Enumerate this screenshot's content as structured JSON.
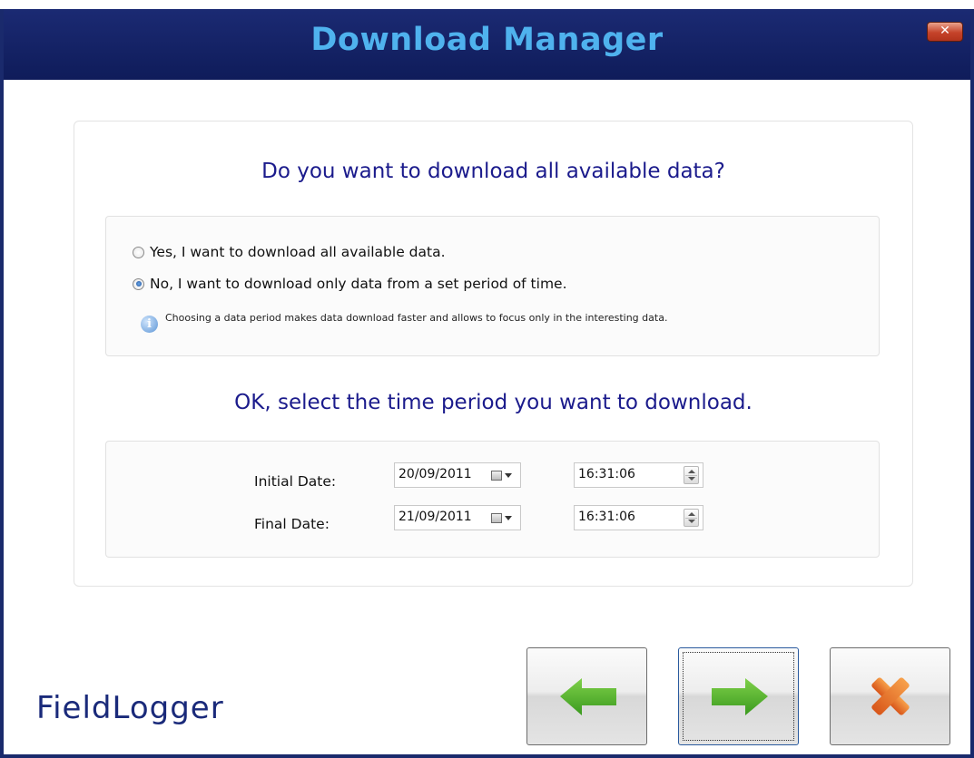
{
  "window": {
    "title": "Download Manager",
    "close_label": "✕"
  },
  "question": "Do you want to download all available data?",
  "options": [
    {
      "label": "Yes, I want to download all available data.",
      "selected": false
    },
    {
      "label": "No, I want to download only data from a set period of time.",
      "selected": true
    }
  ],
  "info": "Choosing a data period makes data download faster and allows to focus only in the interesting data.",
  "period_question": "OK, select the time period you want to download.",
  "initial": {
    "label": "Initial Date:",
    "date": "20/09/2011",
    "time": "16:31:06"
  },
  "final": {
    "label": "Final Date:",
    "date": "21/09/2011",
    "time": "16:31:06"
  },
  "logo": "FieldLogger",
  "colors": {
    "titlebar": "#1b2a73",
    "title_text": "#4fb2ee",
    "heading": "#1b1b8c",
    "arrow_green": "#4cae2a",
    "close_orange": "#e8701e"
  },
  "buttons": {
    "back": "arrow-left-icon",
    "next": "arrow-right-icon",
    "cancel": "x-icon"
  }
}
